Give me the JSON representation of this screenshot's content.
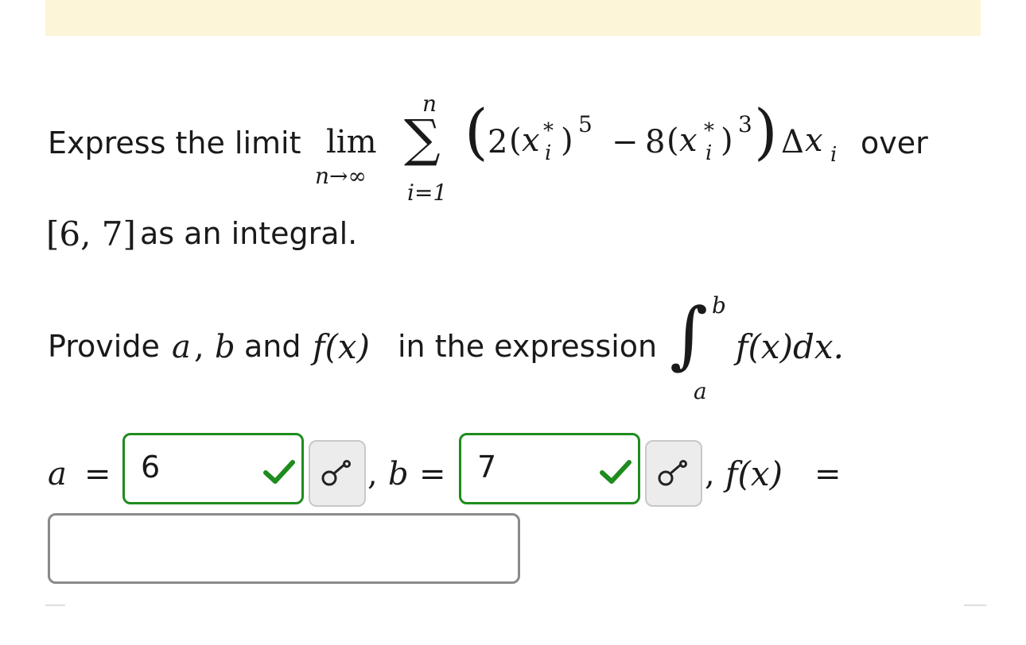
{
  "problem": {
    "line1_prefix": "Express the limit",
    "lim_word": "lim",
    "lim_sub": "n→∞",
    "sum_upper": "n",
    "sum_lower": "i=1",
    "term_coef1": "2",
    "term_var": "x",
    "term_star": "*",
    "term_i": "i",
    "exp1": "5",
    "minus": "−",
    "term_coef2": "8",
    "exp2": "3",
    "delta": "Δ",
    "line1_suffix": "over",
    "interval": "[6, 7]",
    "line2_suffix": "as an integral."
  },
  "provide": {
    "prefix": "Provide",
    "a": "a",
    "comma": ",",
    "b": "b",
    "and": "and",
    "fx": "f(x)",
    "middle": "in the expression",
    "int_upper": "b",
    "int_lower": "a",
    "integrand": "f(x)dx."
  },
  "answers": {
    "a_label": "a",
    "b_label": "b",
    "eq": "=",
    "sep": ",",
    "f_label": "f(x)",
    "a_value": "6",
    "b_value": "7",
    "f_value": "",
    "check_color": "#1e8c1e"
  }
}
